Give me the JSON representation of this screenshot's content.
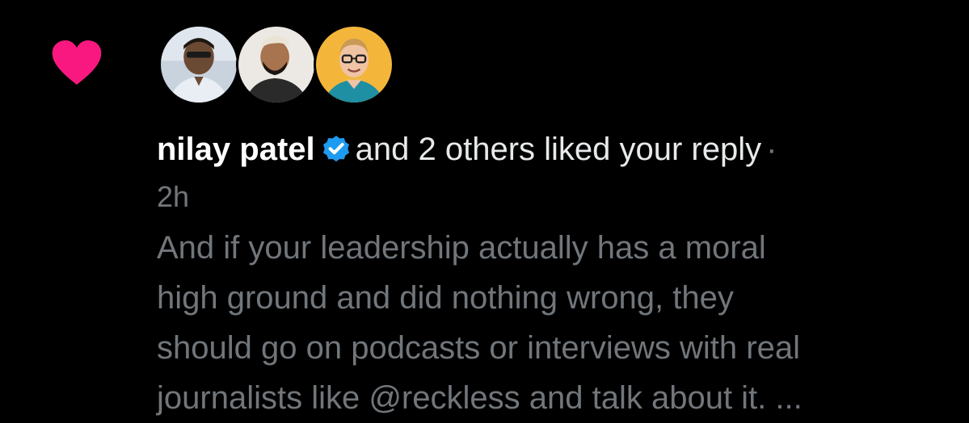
{
  "notification": {
    "type_icon": "heart-icon",
    "accent_color": "#f91880",
    "avatars": [
      {
        "icon": "avatar-photo-man-sunglasses"
      },
      {
        "icon": "avatar-photo-man-beard"
      },
      {
        "icon": "avatar-photo-man-glasses"
      }
    ],
    "actor_name": "nilay patel",
    "verified_icon": "verified-badge-icon",
    "verified_color": "#1d9bf0",
    "action_text": "and 2 others liked your reply",
    "separator": "·",
    "timestamp": "2h",
    "reply_text": "And if your leadership actually has a moral\nhigh ground and did nothing wrong, they\nshould go on podcasts or interviews with real\njournalists like @reckless and talk about it. ..."
  }
}
